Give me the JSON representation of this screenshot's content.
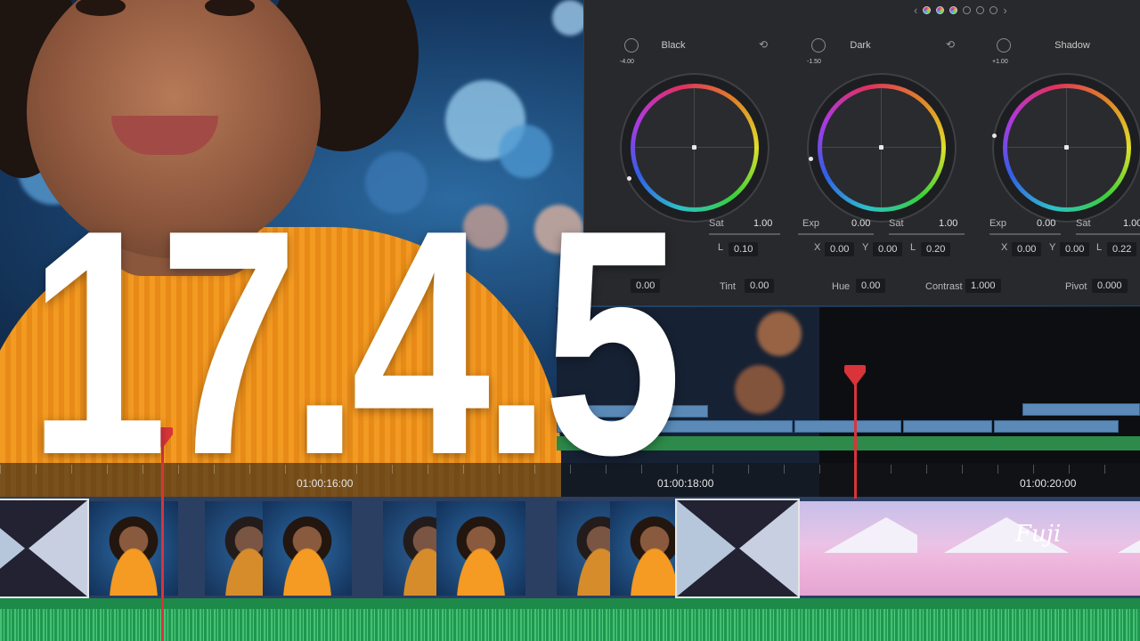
{
  "hero": {
    "version": "17.4.5"
  },
  "color_panel": {
    "pager": {
      "prev": "‹",
      "next": "›",
      "pages": 6,
      "active_pages": 3
    },
    "wheels": [
      {
        "name": "Black",
        "value": "-4.00",
        "exp": "",
        "sat": "1.00",
        "x": "",
        "y": "",
        "l": "0.10"
      },
      {
        "name": "Dark",
        "value": "-1.50",
        "exp": "0.00",
        "sat": "1.00",
        "x": "0.00",
        "y": "0.00",
        "l": "0.20"
      },
      {
        "name": "Shadow",
        "value": "+1.00",
        "exp": "0.00",
        "sat": "1.00",
        "x": "0.00",
        "y": "0.00",
        "l": "0.22"
      }
    ],
    "labels": {
      "exp": "Exp",
      "sat": "Sat",
      "x": "X",
      "y": "Y",
      "l": "L"
    },
    "bottom_row": {
      "first_value": "0.00",
      "tint_label": "Tint",
      "tint": "0.00",
      "hue_label": "Hue",
      "hue": "0.00",
      "contrast_label": "Contrast",
      "contrast": "1.000",
      "pivot_label": "Pivot",
      "pivot": "0.000"
    }
  },
  "timeline": {
    "timecodes": [
      "01:00:16:00",
      "01:00:18:00",
      "01:00:20:00"
    ],
    "clip_text": "Fuji"
  },
  "icons": {
    "reset": "reset-icon",
    "knob": "adjust-knob-icon",
    "playhead": "playhead-marker-icon"
  },
  "colors": {
    "accent_playhead": "#d8343a",
    "sweater": "#f29a22",
    "video_track": "#2b3f63",
    "audio_track": "#1e8a4a",
    "panel_bg": "#28292c"
  }
}
